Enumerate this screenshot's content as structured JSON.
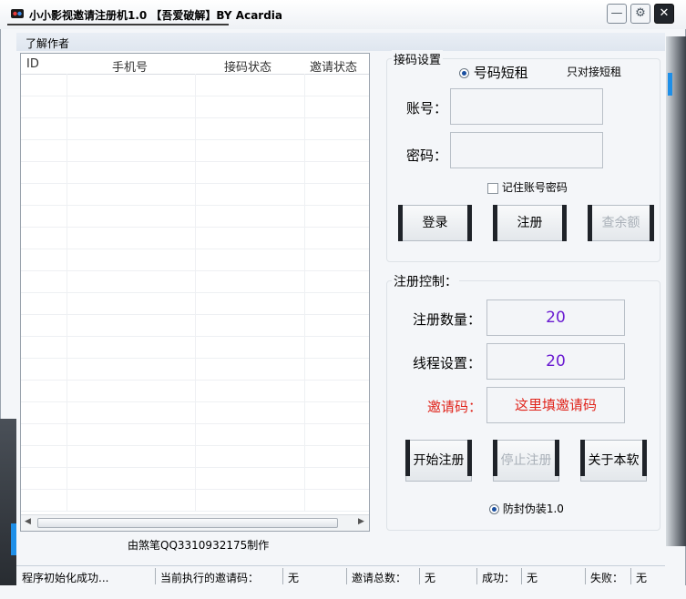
{
  "window": {
    "title": "小小影视邀请注册机1.0 【吾爱破解】BY Acardia",
    "controls": {
      "minimize": "—",
      "settings": "⚙",
      "close": "✕"
    }
  },
  "menu": {
    "about_author": "了解作者"
  },
  "table": {
    "columns": [
      "ID",
      "手机号",
      "接码状态",
      "邀请状态"
    ],
    "rows": []
  },
  "credit": "由煞笔QQ3310932175制作",
  "sms_group": {
    "title": "接码设置",
    "radio_label": "号码短租",
    "radio_hint": "只对接短租",
    "account_label": "账号：",
    "account_value": "",
    "password_label": "密码：",
    "password_value": "",
    "remember_label": "记住账号密码",
    "login_button": "登录",
    "register_button": "注册",
    "balance_button": "查余额"
  },
  "reg_group": {
    "title": "注册控制：",
    "count_label": "注册数量：",
    "count_value": "20",
    "thread_label": "线程设置：",
    "thread_value": "20",
    "invite_label": "邀请码：",
    "invite_value": "这里填邀请码",
    "start_button": "开始注册",
    "stop_button": "停止注册",
    "about_button": "关于本软",
    "disguise_label": "防封伪装1.0"
  },
  "status": {
    "init": "程序初始化成功...",
    "current_label": "当前执行的邀请码：",
    "current_value": "无",
    "total_label": "邀请总数：",
    "total_value": "无",
    "success_label": "成功：",
    "success_value": "无",
    "fail_label": "失败：",
    "fail_value": "无"
  },
  "colors": {
    "value_purple": "#6a1bd1",
    "invite_red": "#e0241b",
    "accent_blue": "#1e8fe8"
  }
}
